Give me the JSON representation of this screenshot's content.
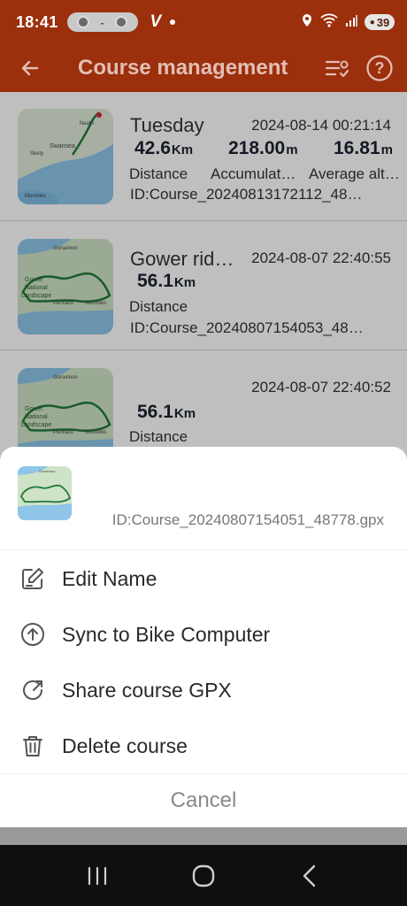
{
  "status_bar": {
    "time": "18:41",
    "pill_text": "-",
    "app_glyph": "V",
    "battery": "39",
    "icons": [
      "location-icon",
      "wifi-icon",
      "signal-icon"
    ]
  },
  "header": {
    "title": "Course management",
    "back_icon": "arrow-left-icon",
    "actions": [
      "checklist-icon",
      "help-icon"
    ],
    "help_label": "?",
    "bg_color": "#9c2f0c"
  },
  "courses": [
    {
      "name": "Tuesday",
      "date": "2024-08-14 00:21:14",
      "distance_value": "42.6",
      "distance_unit": "Km",
      "distance_label": "Distance",
      "accum_value": "218.00",
      "accum_unit": "m",
      "accum_label": "Accumulat…",
      "alt_value": "16.81",
      "alt_unit": "m",
      "alt_label": "Average alt…",
      "id": "ID:Course_20240813172112_48…",
      "map_labels": [
        "Swansea",
        "Skety",
        "Mumbles",
        "Neath"
      ]
    },
    {
      "name": "Gower rid…",
      "date": "2024-08-07 22:40:55",
      "distance_value": "56.1",
      "distance_unit": "Km",
      "distance_label": "Distance",
      "id": "ID:Course_20240807154053_48…",
      "map_labels": [
        "Gorseinon",
        "Gower",
        "National",
        "Landscape",
        "Pennard",
        "Mumbles"
      ]
    },
    {
      "name": "",
      "date": "2024-08-07 22:40:52",
      "distance_value": "56.1",
      "distance_unit": "Km",
      "distance_label": "Distance",
      "map_labels": [
        "Gorseinon",
        "Gower",
        "National",
        "Landscape",
        "Pennard",
        "Mumbles"
      ]
    }
  ],
  "sheet": {
    "course_id": "ID:Course_20240807154051_48778.gpx",
    "thumb_label": "Gorseinon",
    "actions": [
      {
        "label": "Edit Name",
        "icon": "edit-icon"
      },
      {
        "label": "Sync to Bike Computer",
        "icon": "upload-circle-icon"
      },
      {
        "label": "Share course GPX",
        "icon": "share-arrow-icon"
      },
      {
        "label": "Delete course",
        "icon": "trash-icon"
      }
    ],
    "cancel": "Cancel"
  },
  "nav": {
    "buttons": [
      "recent-apps-icon",
      "home-icon",
      "back-nav-icon"
    ]
  }
}
